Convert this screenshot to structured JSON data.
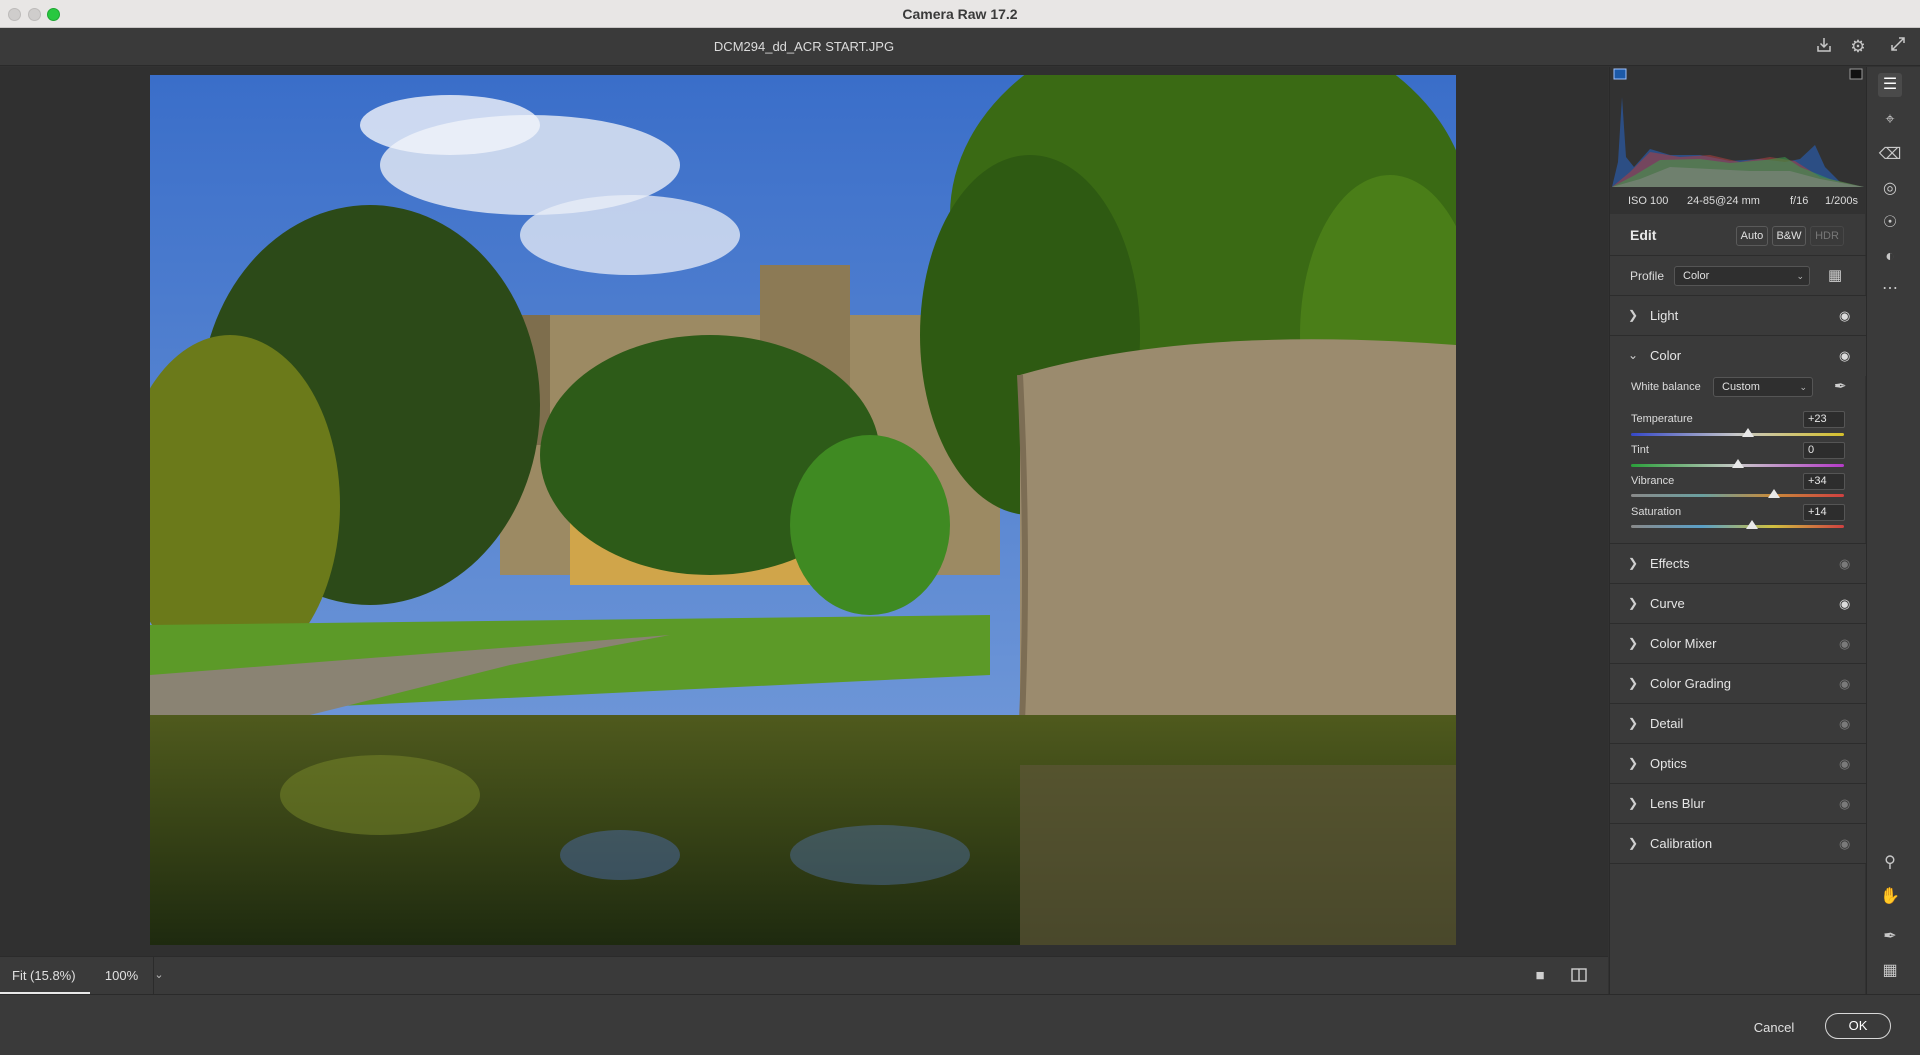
{
  "window": {
    "title": "Camera Raw 17.2"
  },
  "document": {
    "file_name": "DCM294_dd_ACR START.JPG"
  },
  "toolbar_top": {
    "icons": [
      "save-icon",
      "gear-icon",
      "fullscreen-icon"
    ]
  },
  "zoom": {
    "fit_label": "Fit (15.8%)",
    "percent_label": "100%"
  },
  "exif": {
    "iso": "ISO 100",
    "lens": "24-85@24 mm",
    "aperture": "f/16",
    "shutter": "1/200s"
  },
  "edit": {
    "title": "Edit",
    "auto": "Auto",
    "bw": "B&W",
    "hdr": "HDR"
  },
  "profile": {
    "label": "Profile",
    "value": "Color"
  },
  "sections": {
    "light": "Light",
    "color": "Color",
    "effects": "Effects",
    "curve": "Curve",
    "color_mixer": "Color Mixer",
    "color_grading": "Color Grading",
    "detail": "Detail",
    "optics": "Optics",
    "lens_blur": "Lens Blur",
    "calibration": "Calibration"
  },
  "color_panel": {
    "white_balance_label": "White balance",
    "white_balance_value": "Custom",
    "sliders": [
      {
        "label": "Temperature",
        "value": "+23",
        "level": 0.55
      },
      {
        "label": "Tint",
        "value": "0",
        "level": 0.5
      },
      {
        "label": "Vibrance",
        "value": "+34",
        "level": 0.67
      },
      {
        "label": "Saturation",
        "value": "+14",
        "level": 0.57
      }
    ]
  },
  "footer": {
    "cancel": "Cancel",
    "ok": "OK"
  }
}
